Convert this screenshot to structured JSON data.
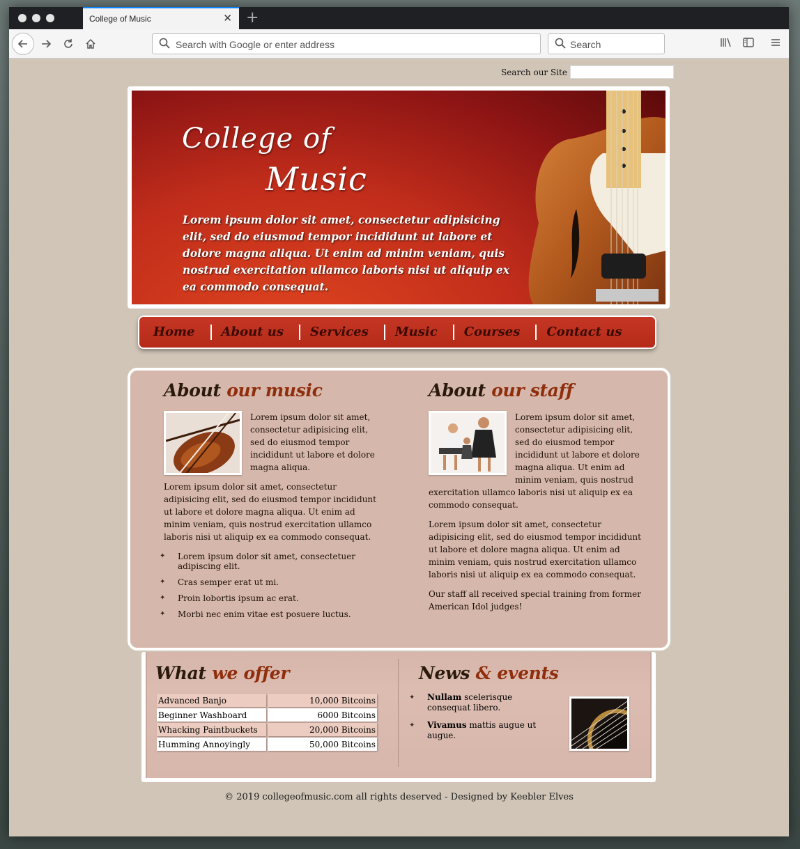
{
  "browser": {
    "tab_title": "College of Music",
    "url_placeholder": "Search with Google or enter address",
    "search_placeholder": "Search"
  },
  "site_search": {
    "label": "Search our Site",
    "value": ""
  },
  "banner": {
    "title_line1": "College of",
    "title_line2": "Music",
    "tagline": "Lorem ipsum dolor sit amet, consectetur adipisicing elit, sed do eiusmod tempor incididunt ut labore et dolore magna aliqua. Ut enim ad minim veniam, quis nostrud exercitation ullamco laboris nisi ut aliquip ex ea commodo consequat."
  },
  "nav": {
    "items": [
      {
        "label": "Home"
      },
      {
        "label": "About us"
      },
      {
        "label": "Services"
      },
      {
        "label": "Music"
      },
      {
        "label": "Courses"
      },
      {
        "label": "Contact us"
      }
    ]
  },
  "about_music": {
    "heading_main": "About",
    "heading_accent": "our music",
    "paragraphs": [
      "Lorem ipsum dolor sit amet, consectetur adipisicing elit, sed do eiusmod tempor incididunt ut labore et dolore magna aliqua.",
      "Lorem ipsum dolor sit amet, consectetur adipisicing elit, sed do eiusmod tempor incididunt ut labore et dolore magna aliqua. Ut enim ad minim veniam, quis nostrud exercitation ullamco laboris nisi ut aliquip ex ea commodo consequat."
    ],
    "bullets": [
      "Lorem ipsum dolor sit amet, consectetuer adipiscing elit.",
      "Cras semper erat ut mi.",
      "Proin lobortis ipsum ac erat.",
      "Morbi nec enim vitae est posuere luctus."
    ]
  },
  "about_staff": {
    "heading_main": "About",
    "heading_accent": "our staff",
    "paragraphs": [
      "Lorem ipsum dolor sit amet, consectetur adipisicing elit, sed do eiusmod tempor incididunt ut labore et dolore magna aliqua. Ut enim ad minim veniam, quis nostrud exercitation ullamco laboris nisi ut aliquip ex ea commodo consequat.",
      "Lorem ipsum dolor sit amet, consectetur adipisicing elit, sed do eiusmod tempor incididunt ut labore et dolore magna aliqua. Ut enim ad minim veniam, quis nostrud exercitation ullamco laboris nisi ut aliquip ex ea commodo consequat.",
      "Our staff all received special training from former American Idol judges!"
    ]
  },
  "offer": {
    "heading_main": "What",
    "heading_accent": "we offer",
    "rows": [
      {
        "item": "Advanced Banjo",
        "price": "10,000 Bitcoins"
      },
      {
        "item": "Beginner Washboard",
        "price": "6000 Bitcoins"
      },
      {
        "item": "Whacking Paintbuckets",
        "price": "20,000 Bitcoins"
      },
      {
        "item": "Humming Annoyingly",
        "price": "50,000 Bitcoins"
      }
    ]
  },
  "news": {
    "heading_main": "News",
    "heading_accent": "& events",
    "items": [
      {
        "bold": "Nullam",
        "text": " scelerisque consequat libero."
      },
      {
        "bold": "Vivamus",
        "text": " mattis augue ut augue."
      }
    ]
  },
  "footer": {
    "text": "© 2019 collegeofmusic.com all rights deserved - Designed by Keebler Elves"
  },
  "colors": {
    "banner_red": "#c12d1b",
    "accent_brown": "#8f2e0d",
    "content_bg": "#d6b7ab",
    "page_bg": "#d0c5b7"
  }
}
